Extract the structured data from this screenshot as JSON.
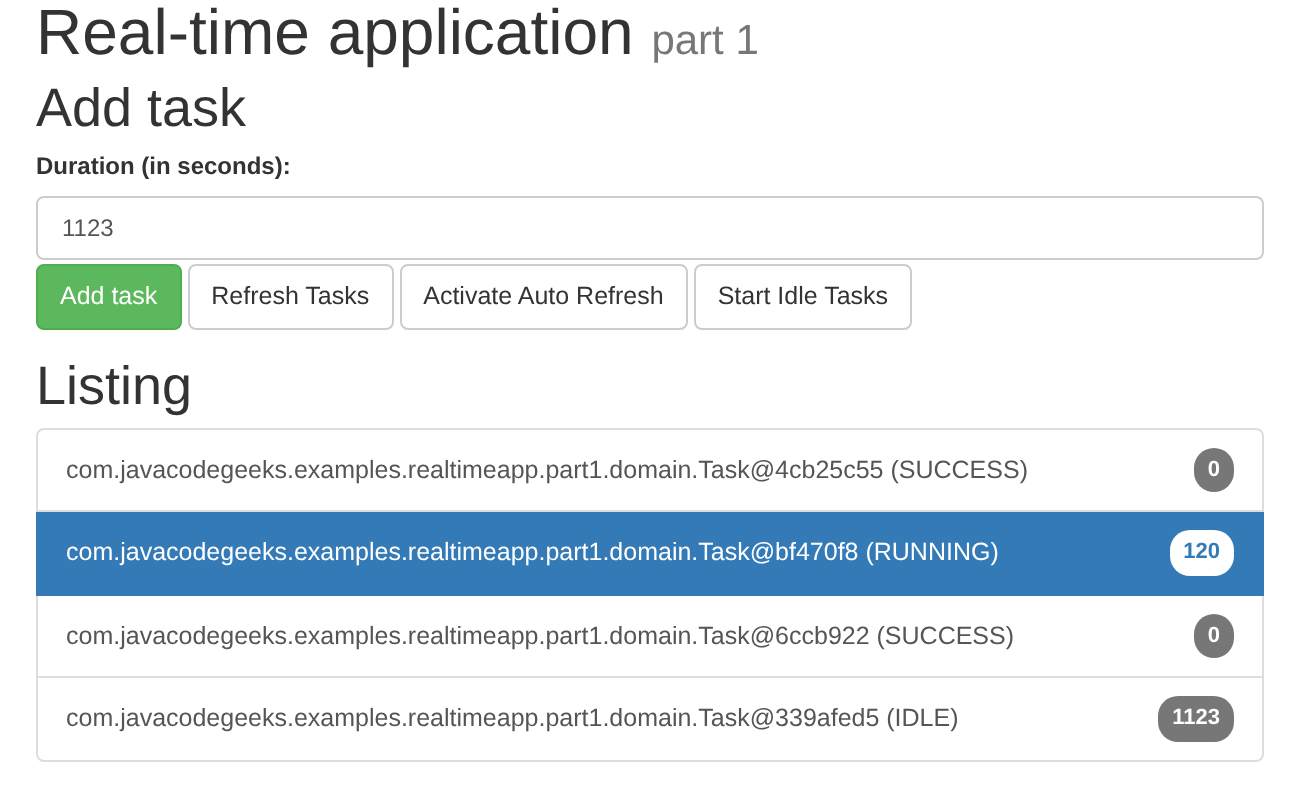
{
  "header": {
    "title": "Real-time application",
    "subtitle": "part 1"
  },
  "add_task": {
    "heading": "Add task",
    "label": "Duration (in seconds):",
    "value": "1123",
    "buttons": [
      {
        "label": "Add task",
        "kind": "success"
      },
      {
        "label": "Refresh Tasks",
        "kind": "default"
      },
      {
        "label": "Activate Auto Refresh",
        "kind": "default"
      },
      {
        "label": "Start Idle Tasks",
        "kind": "default"
      }
    ]
  },
  "listing": {
    "heading": "Listing",
    "items": [
      {
        "text": "com.javacodegeeks.examples.realtimeapp.part1.domain.Task@4cb25c55 (SUCCESS)",
        "count": "0",
        "selected": false
      },
      {
        "text": "com.javacodegeeks.examples.realtimeapp.part1.domain.Task@bf470f8 (RUNNING)",
        "count": "120",
        "selected": true
      },
      {
        "text": "com.javacodegeeks.examples.realtimeapp.part1.domain.Task@6ccb922 (SUCCESS)",
        "count": "0",
        "selected": false
      },
      {
        "text": "com.javacodegeeks.examples.realtimeapp.part1.domain.Task@339afed5 (IDLE)",
        "count": "1123",
        "selected": false
      }
    ]
  }
}
